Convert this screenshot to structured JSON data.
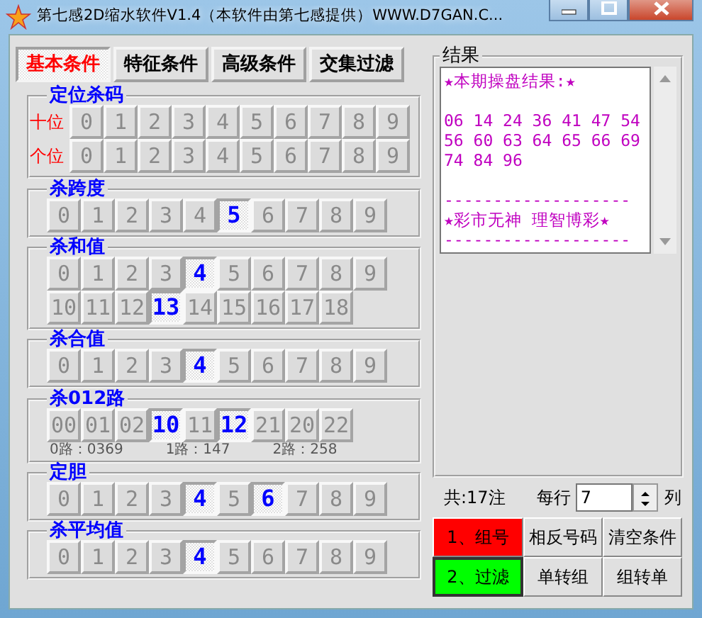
{
  "window": {
    "title": "第七感2D缩水软件V1.4（本软件由第七感提供）WWW.D7GAN.C..."
  },
  "tabs": [
    {
      "label": "基本条件",
      "selected": true
    },
    {
      "label": "特征条件",
      "selected": false
    },
    {
      "label": "高级条件",
      "selected": false
    },
    {
      "label": "交集过滤",
      "selected": false
    }
  ],
  "groups": [
    {
      "title": "定位杀码",
      "rows": [
        {
          "label": "十位",
          "buttons": [
            {
              "text": "0",
              "selected": false
            },
            {
              "text": "1",
              "selected": false
            },
            {
              "text": "2",
              "selected": false
            },
            {
              "text": "3",
              "selected": false
            },
            {
              "text": "4",
              "selected": false
            },
            {
              "text": "5",
              "selected": false
            },
            {
              "text": "6",
              "selected": false
            },
            {
              "text": "7",
              "selected": false
            },
            {
              "text": "8",
              "selected": false
            },
            {
              "text": "9",
              "selected": false
            }
          ]
        },
        {
          "label": "个位",
          "buttons": [
            {
              "text": "0",
              "selected": false
            },
            {
              "text": "1",
              "selected": false
            },
            {
              "text": "2",
              "selected": false
            },
            {
              "text": "3",
              "selected": false
            },
            {
              "text": "4",
              "selected": false
            },
            {
              "text": "5",
              "selected": false
            },
            {
              "text": "6",
              "selected": false
            },
            {
              "text": "7",
              "selected": false
            },
            {
              "text": "8",
              "selected": false
            },
            {
              "text": "9",
              "selected": false
            }
          ]
        }
      ]
    },
    {
      "title": "杀跨度",
      "rows": [
        {
          "buttons": [
            {
              "text": "0",
              "selected": false
            },
            {
              "text": "1",
              "selected": false
            },
            {
              "text": "2",
              "selected": false
            },
            {
              "text": "3",
              "selected": false
            },
            {
              "text": "4",
              "selected": false
            },
            {
              "text": "5",
              "selected": true
            },
            {
              "text": "6",
              "selected": false
            },
            {
              "text": "7",
              "selected": false
            },
            {
              "text": "8",
              "selected": false
            },
            {
              "text": "9",
              "selected": false
            }
          ]
        }
      ]
    },
    {
      "title": "杀和值",
      "rows": [
        {
          "buttons": [
            {
              "text": "0",
              "selected": false
            },
            {
              "text": "1",
              "selected": false
            },
            {
              "text": "2",
              "selected": false
            },
            {
              "text": "3",
              "selected": false
            },
            {
              "text": "4",
              "selected": true
            },
            {
              "text": "5",
              "selected": false
            },
            {
              "text": "6",
              "selected": false
            },
            {
              "text": "7",
              "selected": false
            },
            {
              "text": "8",
              "selected": false
            },
            {
              "text": "9",
              "selected": false
            }
          ]
        },
        {
          "buttons": [
            {
              "text": "10",
              "selected": false
            },
            {
              "text": "11",
              "selected": false
            },
            {
              "text": "12",
              "selected": false
            },
            {
              "text": "13",
              "selected": true
            },
            {
              "text": "14",
              "selected": false
            },
            {
              "text": "15",
              "selected": false
            },
            {
              "text": "16",
              "selected": false
            },
            {
              "text": "17",
              "selected": false
            },
            {
              "text": "18",
              "selected": false
            }
          ]
        }
      ]
    },
    {
      "title": "杀合值",
      "rows": [
        {
          "buttons": [
            {
              "text": "0",
              "selected": false
            },
            {
              "text": "1",
              "selected": false
            },
            {
              "text": "2",
              "selected": false
            },
            {
              "text": "3",
              "selected": false
            },
            {
              "text": "4",
              "selected": true
            },
            {
              "text": "5",
              "selected": false
            },
            {
              "text": "6",
              "selected": false
            },
            {
              "text": "7",
              "selected": false
            },
            {
              "text": "8",
              "selected": false
            },
            {
              "text": "9",
              "selected": false
            }
          ]
        }
      ]
    },
    {
      "title": "杀012路",
      "rows": [
        {
          "buttons": [
            {
              "text": "00",
              "selected": false
            },
            {
              "text": "01",
              "selected": false
            },
            {
              "text": "02",
              "selected": false
            },
            {
              "text": "10",
              "selected": true
            },
            {
              "text": "11",
              "selected": false
            },
            {
              "text": "12",
              "selected": true
            },
            {
              "text": "21",
              "selected": false
            },
            {
              "text": "20",
              "selected": false
            },
            {
              "text": "22",
              "selected": false
            }
          ]
        }
      ],
      "notes": [
        "0路：0369",
        "1路：147",
        "2路：258"
      ]
    },
    {
      "title": "定胆",
      "rows": [
        {
          "buttons": [
            {
              "text": "0",
              "selected": false
            },
            {
              "text": "1",
              "selected": false
            },
            {
              "text": "2",
              "selected": false
            },
            {
              "text": "3",
              "selected": false
            },
            {
              "text": "4",
              "selected": true
            },
            {
              "text": "5",
              "selected": false
            },
            {
              "text": "6",
              "selected": true
            },
            {
              "text": "7",
              "selected": false
            },
            {
              "text": "8",
              "selected": false
            },
            {
              "text": "9",
              "selected": false
            }
          ]
        }
      ]
    },
    {
      "title": "杀平均值",
      "rows": [
        {
          "buttons": [
            {
              "text": "0",
              "selected": false
            },
            {
              "text": "1",
              "selected": false
            },
            {
              "text": "2",
              "selected": false
            },
            {
              "text": "3",
              "selected": false
            },
            {
              "text": "4",
              "selected": true
            },
            {
              "text": "5",
              "selected": false
            },
            {
              "text": "6",
              "selected": false
            },
            {
              "text": "7",
              "selected": false
            },
            {
              "text": "8",
              "selected": false
            },
            {
              "text": "9",
              "selected": false
            }
          ]
        }
      ]
    }
  ],
  "result": {
    "title": "结果",
    "paragraphs": [
      [
        "★本期操盘结果:★"
      ],
      [
        "06 14 24 36 41 47 54",
        "56 60 63 64 65 66 69",
        "74 84 96"
      ],
      [
        "-------------------",
        "★彩市无神 理智博彩★",
        "-------------------"
      ]
    ]
  },
  "count": "共:17注",
  "per_row": {
    "label": "每行",
    "value": "7",
    "unit": "列"
  },
  "actions": [
    {
      "label": "1、组号",
      "color": "#ff0000",
      "selected": false
    },
    {
      "label": "相反号码",
      "selected": false
    },
    {
      "label": "清空条件",
      "selected": false
    },
    {
      "label": "2、过滤",
      "color": "#00ff00",
      "selected": true
    },
    {
      "label": "单转组",
      "selected": false
    },
    {
      "label": "组转单",
      "selected": false
    }
  ]
}
